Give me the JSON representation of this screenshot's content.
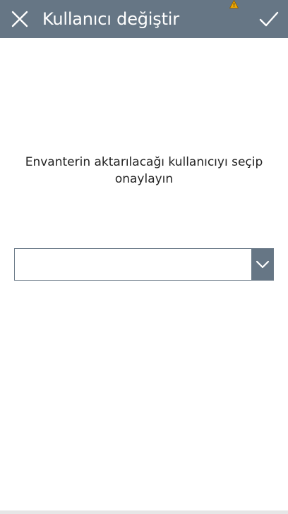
{
  "header": {
    "title": "Kullanıcı değiştir",
    "close_icon": "close-icon",
    "confirm_icon": "checkmark-icon",
    "warning_icon": "warning-icon"
  },
  "main": {
    "instruction": "Envanterin aktarılacağı kullanıcıyı seçip onaylayın",
    "user_select": {
      "selected_value": "",
      "arrow_icon": "chevron-down-icon"
    }
  },
  "colors": {
    "header_bg": "#667685",
    "warning": "#f2a900",
    "select_border": "#6b7a88",
    "select_arrow_bg": "#667685",
    "text": "#222222",
    "bottom_bar": "#e6e6e6"
  }
}
